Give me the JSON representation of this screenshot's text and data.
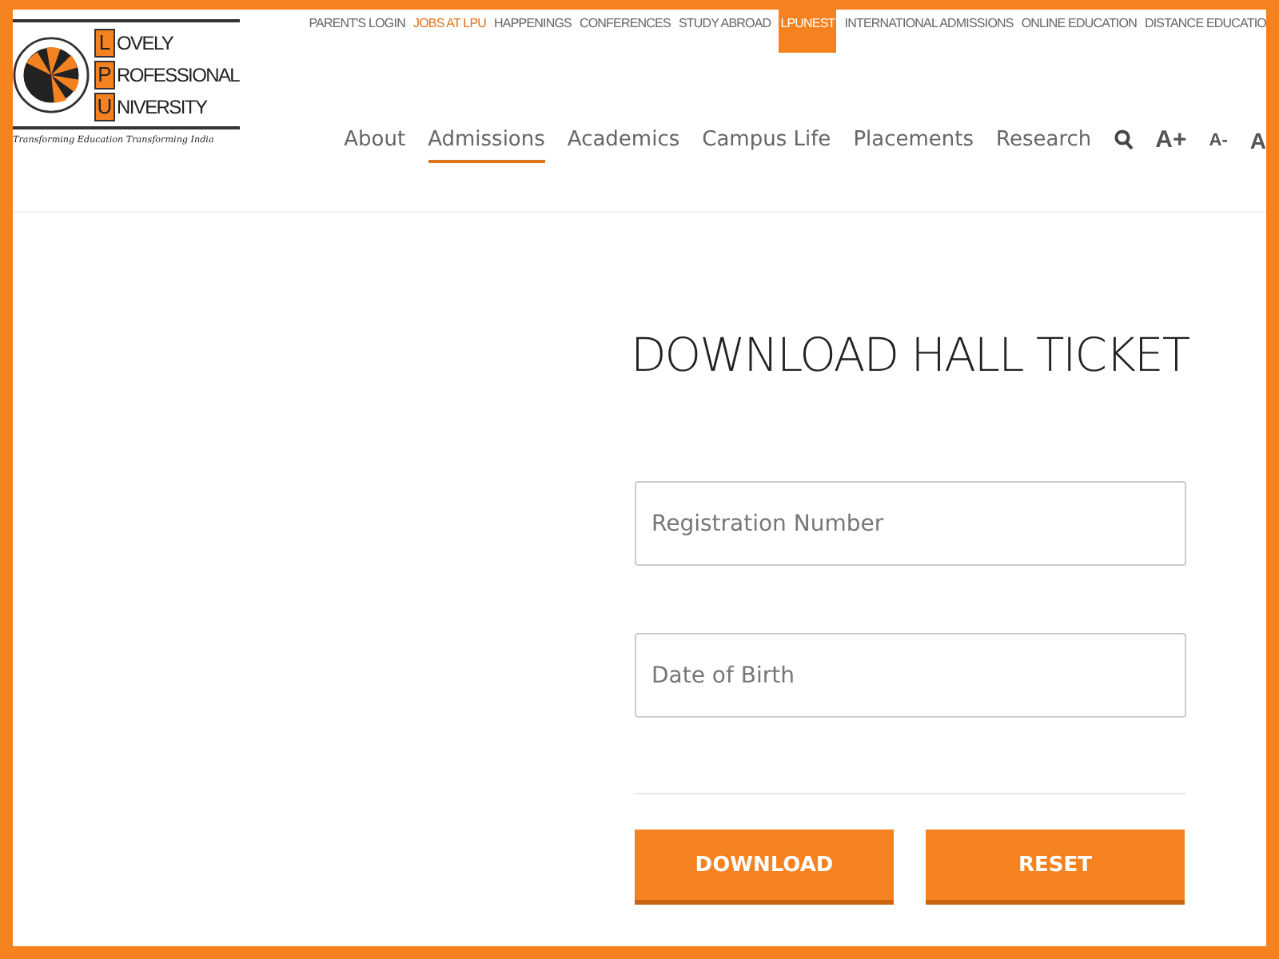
{
  "logo": {
    "letters": [
      {
        "initial": "L",
        "rest": "OVELY"
      },
      {
        "initial": "P",
        "rest": "ROFESSIONAL"
      },
      {
        "initial": "U",
        "rest": "NIVERSITY"
      }
    ],
    "tagline": "Transforming Education Transforming India"
  },
  "top_links": [
    {
      "label": "PARENT'S LOGIN",
      "accent": false,
      "selected": false
    },
    {
      "label": "JOBS AT LPU",
      "accent": true,
      "selected": false
    },
    {
      "label": "HAPPENINGS",
      "accent": false,
      "selected": false
    },
    {
      "label": "CONFERENCES",
      "accent": false,
      "selected": false
    },
    {
      "label": "STUDY ABROAD",
      "accent": false,
      "selected": false
    },
    {
      "label": "LPUNEST",
      "accent": false,
      "selected": true
    },
    {
      "label": "INTERNATIONAL ADMISSIONS",
      "accent": false,
      "selected": false
    },
    {
      "label": "ONLINE EDUCATION",
      "accent": false,
      "selected": false
    },
    {
      "label": "DISTANCE EDUCATIO",
      "accent": false,
      "selected": false
    }
  ],
  "main_nav": [
    {
      "label": "About",
      "selected": false
    },
    {
      "label": "Admissions",
      "selected": true
    },
    {
      "label": "Academics",
      "selected": false
    },
    {
      "label": "Campus Life",
      "selected": false
    },
    {
      "label": "Placements",
      "selected": false
    },
    {
      "label": "Research",
      "selected": false
    }
  ],
  "font_controls": [
    "A+",
    "A-",
    "A"
  ],
  "form": {
    "title": "DOWNLOAD HALL TICKET",
    "fields": [
      {
        "placeholder": "Registration Number"
      },
      {
        "placeholder": "Date of Birth"
      }
    ],
    "buttons": [
      "DOWNLOAD",
      "RESET"
    ]
  }
}
